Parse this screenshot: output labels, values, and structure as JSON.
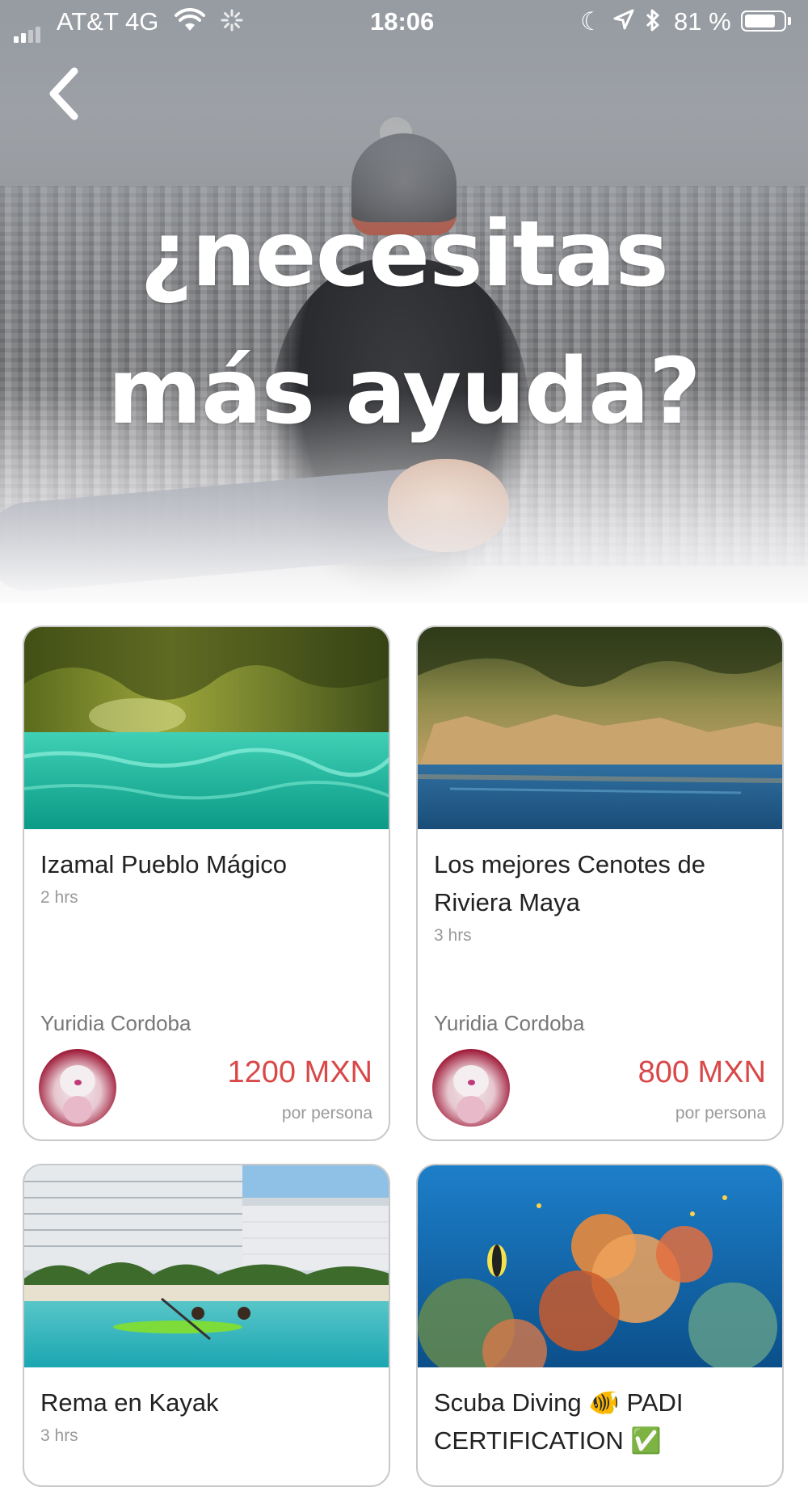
{
  "status_bar": {
    "carrier": "AT&T 4G",
    "time": "18:06",
    "battery": "81 %",
    "battery_level": 0.81
  },
  "hero": {
    "title_line1": "¿necesitas",
    "title_line2": "más ayuda?"
  },
  "cards": [
    {
      "title": "Izamal Pueblo Mágico",
      "duration": "2 hrs",
      "guide": "Yuridia Cordoba",
      "price": "1200 MXN",
      "per": "por persona"
    },
    {
      "title": "Los mejores Cenotes de Riviera Maya",
      "duration": "3 hrs",
      "guide": "Yuridia Cordoba",
      "price": "800 MXN",
      "per": "por persona"
    },
    {
      "title": "Rema en Kayak",
      "duration": "3 hrs"
    },
    {
      "title": "Scuba Diving 🐠 PADI CERTIFICATION ✅"
    }
  ]
}
